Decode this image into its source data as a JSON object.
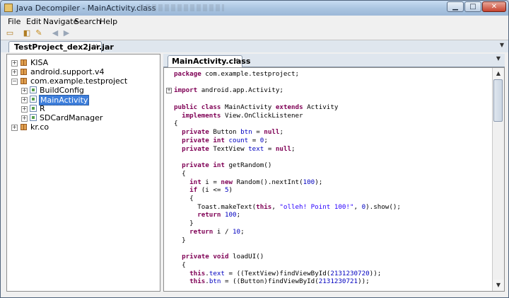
{
  "window": {
    "title": "Java Decompiler - MainActivity.class",
    "app_icon": "jd-icon"
  },
  "menu": [
    "File",
    "Edit",
    "Navigate",
    "Search",
    "Help"
  ],
  "file_tab": {
    "label": "TestProject_dex2jar.jar",
    "close": "×"
  },
  "tree": {
    "items": [
      {
        "label": "KISA",
        "kind": "package",
        "expander": "+"
      },
      {
        "label": "android.support.v4",
        "kind": "package",
        "expander": "+"
      },
      {
        "label": "com.example.testproject",
        "kind": "package",
        "expander": "−"
      },
      {
        "label": "BuildConfig",
        "kind": "class",
        "expander": "+"
      },
      {
        "label": "MainActivity",
        "kind": "class",
        "expander": "+",
        "selected": true
      },
      {
        "label": "R",
        "kind": "class",
        "expander": "+"
      },
      {
        "label": "SDCardManager",
        "kind": "class",
        "expander": "+"
      },
      {
        "label": "kr.co",
        "kind": "package",
        "expander": "+"
      }
    ]
  },
  "code_tab": {
    "label": "MainActivity.class",
    "close": "×"
  },
  "code_lines": [
    "package com.example.testproject;",
    "",
    "import android.app.Activity;",
    "",
    "public class MainActivity extends Activity",
    "  implements View.OnClickListener",
    "{",
    "  private Button btn = null;",
    "  private int count = 0;",
    "  private TextView text = null;",
    "",
    "  private int getRandom()",
    "  {",
    "    int i = new Random().nextInt(100);",
    "    if (i <= 5)",
    "    {",
    "      Toast.makeText(this, \"olleh! Point 100!\", 0).show();",
    "      return 100;",
    "    }",
    "    return i / 10;",
    "  }",
    "",
    "  private void loadUI()",
    "  {",
    "    this.text = ((TextView)findViewById(2131230720));",
    "    this.btn = ((Button)findViewById(2131230721));"
  ],
  "colors": {
    "keyword": "#7f0055",
    "number": "#0000c0",
    "string": "#2a00ff",
    "selection": "#3d7edb"
  }
}
